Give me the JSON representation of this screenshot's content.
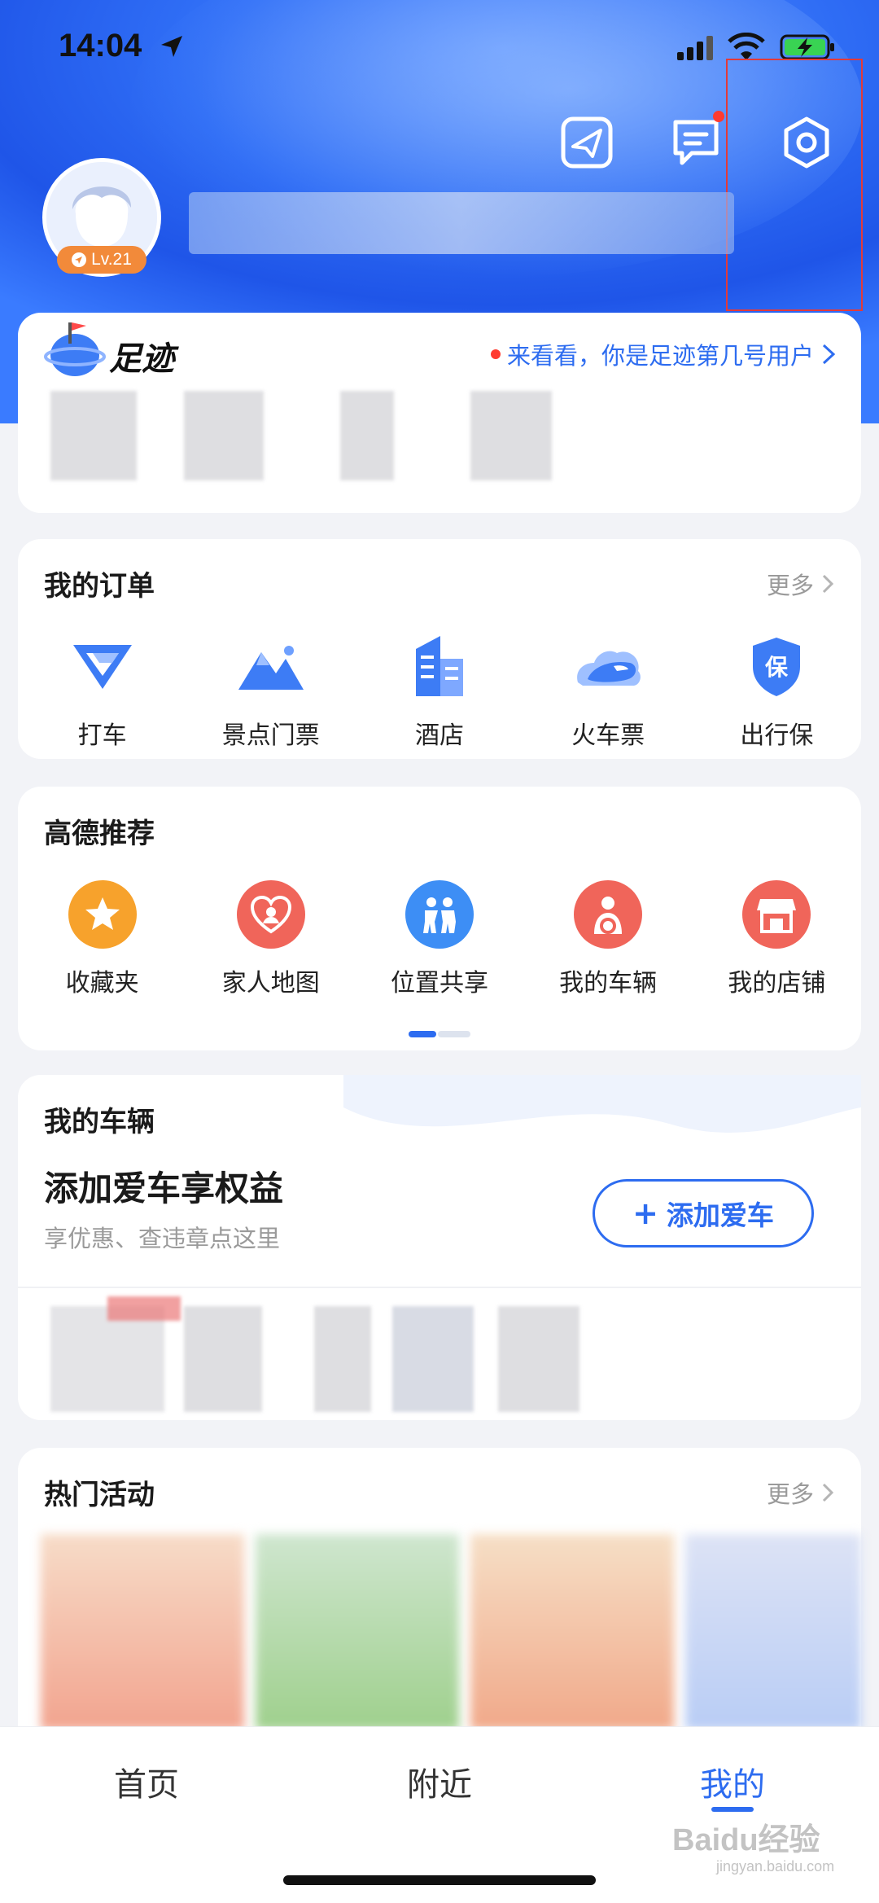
{
  "status_bar": {
    "time": "14:04"
  },
  "profile": {
    "level": "Lv.21"
  },
  "footprint": {
    "title": "足迹",
    "prompt": "来看看，你是足迹第几号用户"
  },
  "orders": {
    "title": "我的订单",
    "more": "更多",
    "items": [
      {
        "label": "打车",
        "icon": "taxi-icon"
      },
      {
        "label": "景点门票",
        "icon": "mountain-icon"
      },
      {
        "label": "酒店",
        "icon": "hotel-building-icon"
      },
      {
        "label": "火车票",
        "icon": "train-icon"
      },
      {
        "label": "出行保",
        "icon": "insurance-shield-icon"
      }
    ]
  },
  "recommend": {
    "title": "高德推荐",
    "items": [
      {
        "label": "收藏夹",
        "icon": "star-icon",
        "color": "#f7a22c"
      },
      {
        "label": "家人地图",
        "icon": "family-heart-icon",
        "color": "#f0655a"
      },
      {
        "label": "位置共享",
        "icon": "people-share-icon",
        "color": "#3d8ef5"
      },
      {
        "label": "我的车辆",
        "icon": "driver-icon",
        "color": "#f0655a"
      },
      {
        "label": "我的店铺",
        "icon": "shop-icon",
        "color": "#f0655a"
      }
    ]
  },
  "vehicle": {
    "title": "我的车辆",
    "headline": "添加爱车享权益",
    "subtitle": "享优惠、查违章点这里",
    "add_button": "添加爱车",
    "add_symbol": "+"
  },
  "hot": {
    "title": "热门活动",
    "more": "更多"
  },
  "tabs": [
    {
      "label": "首页",
      "active": false
    },
    {
      "label": "附近",
      "active": false
    },
    {
      "label": "我的",
      "active": true
    }
  ],
  "watermark": {
    "brand": "Baidu经验",
    "url": "jingyan.baidu.com"
  },
  "colors": {
    "accent": "#2d6cf0",
    "header": "#2f6df5",
    "badge": "#f28a3a",
    "alert": "#ff3b30"
  }
}
